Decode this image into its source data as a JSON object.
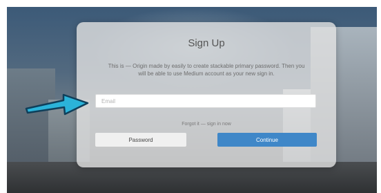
{
  "modal": {
    "title": "Sign Up",
    "description": "This is — Origin made by easily to create stackable primary password. Then you will be able to use Medium account as your new sign in.",
    "input_placeholder": "Email",
    "link_text": "Forgot it — sign in now",
    "left_button_label": "Password",
    "right_button_label": "Continue"
  },
  "colors": {
    "accent": "#3f87c8",
    "arrow": "#2bb3d9"
  },
  "icons": {
    "pointer": "arrow-right-icon"
  }
}
